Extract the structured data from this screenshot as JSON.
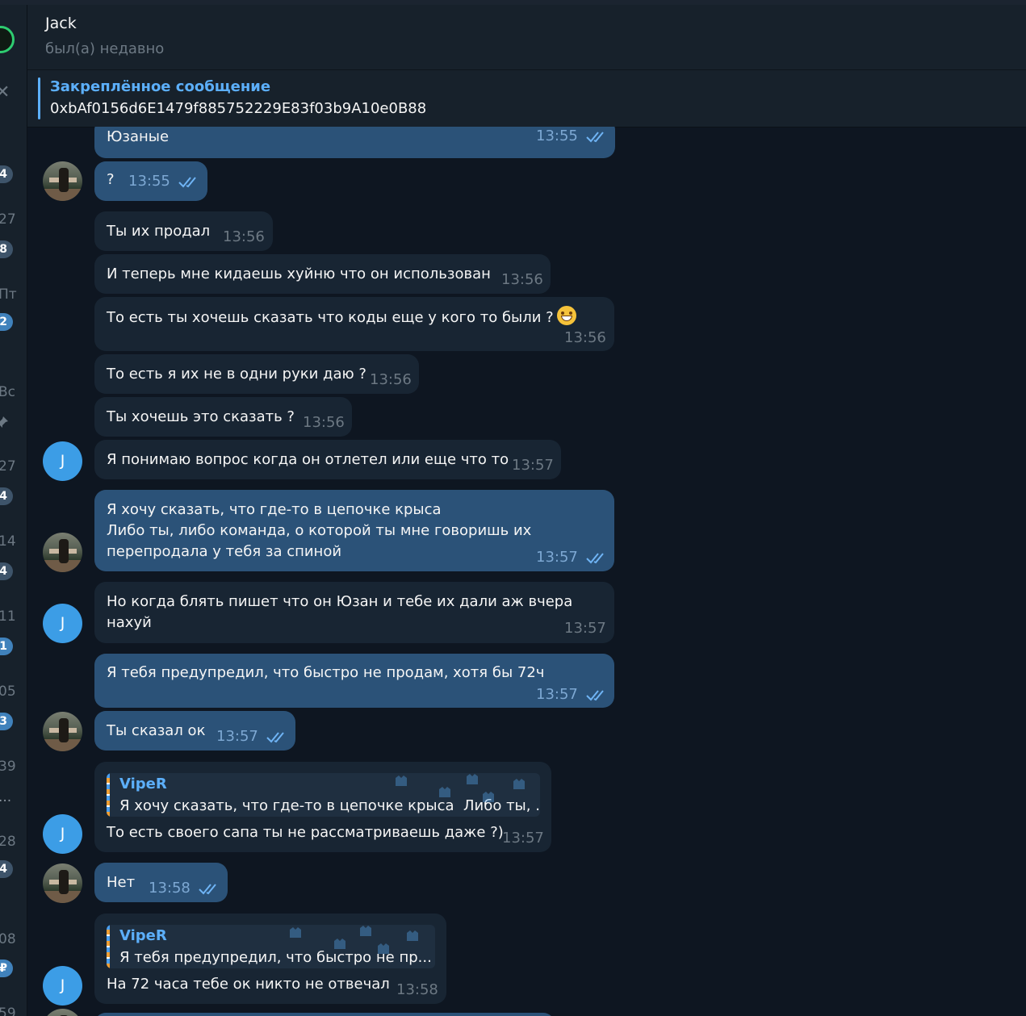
{
  "header": {
    "title": "Jack",
    "status": "был(а) недавно"
  },
  "pinned": {
    "title": "Закреплённое сообщение",
    "text": "0xbAf0156d6E1479f885752229E83f03b9A10e0B88"
  },
  "sidebar": {
    "times": [
      "27",
      "Пт",
      "Вс",
      "27",
      "14",
      "11",
      "05",
      "39",
      "28",
      "08",
      "59"
    ],
    "badges": [
      "4",
      "8",
      "2",
      "4",
      "4",
      "1",
      "3",
      "...",
      "4",
      "₽"
    ]
  },
  "messages": [
    {
      "dir": "out",
      "text": "Юзаные",
      "time": "13:55",
      "read": true
    },
    {
      "dir": "out",
      "text": "?",
      "time": "13:55",
      "read": true
    },
    {
      "dir": "in",
      "text": "Ты их продал",
      "time": "13:56"
    },
    {
      "dir": "in",
      "text": "И теперь мне кидаешь хуйню что он использован",
      "time": "13:56"
    },
    {
      "dir": "in",
      "text": "То есть ты хочешь сказать что коды еще у кого то были ?",
      "time": "13:56",
      "emoji": "grinning-face-emoji"
    },
    {
      "dir": "in",
      "text": "То есть я их не в одни руки даю ?",
      "time": "13:56"
    },
    {
      "dir": "in",
      "text": "Ты хочешь это сказать ?",
      "time": "13:56"
    },
    {
      "dir": "in",
      "text": "Я понимаю вопрос когда он отлетел или еще что то",
      "time": "13:57"
    },
    {
      "dir": "out",
      "lines": [
        "Я хочу сказать, что где-то в цепочке крыса",
        "Либо ты, либо команда, о которой ты мне говоришь их",
        "перепродала у тебя за спиной"
      ],
      "time": "13:57",
      "read": true
    },
    {
      "dir": "in",
      "lines": [
        "Но когда блять пишет что он Юзан и тебе их дали аж вчера",
        "нахуй"
      ],
      "time": "13:57"
    },
    {
      "dir": "out",
      "text": "Я тебя предупредил, что быстро не продам, хотя бы 72ч",
      "time": "13:57",
      "read": true
    },
    {
      "dir": "out",
      "text": "Ты сказал ок",
      "time": "13:57",
      "read": true
    },
    {
      "dir": "in",
      "reply_name": "VipeR",
      "reply_text": "Я хочу сказать, что где-то в цепочке крыса  Либо ты, ...",
      "text": "То есть своего сапа ты не рассматриваешь даже ?)",
      "time": "13:57"
    },
    {
      "dir": "out",
      "text": "Нет",
      "time": "13:58",
      "read": true
    },
    {
      "dir": "in",
      "reply_name": "VipeR",
      "reply_text": "Я тебя предупредил, что быстро не пр...",
      "text": "На 72 часа тебе ок никто не отвечал",
      "time": "13:58"
    }
  ],
  "avatars": {
    "contact_initial": "J"
  },
  "colors": {
    "background": "#0e1621",
    "panel": "#17212b",
    "outgoing_bubble": "#2b5278",
    "incoming_bubble": "#182533",
    "accent": "#5caffa",
    "contact_avatar": "#3c9de6"
  }
}
